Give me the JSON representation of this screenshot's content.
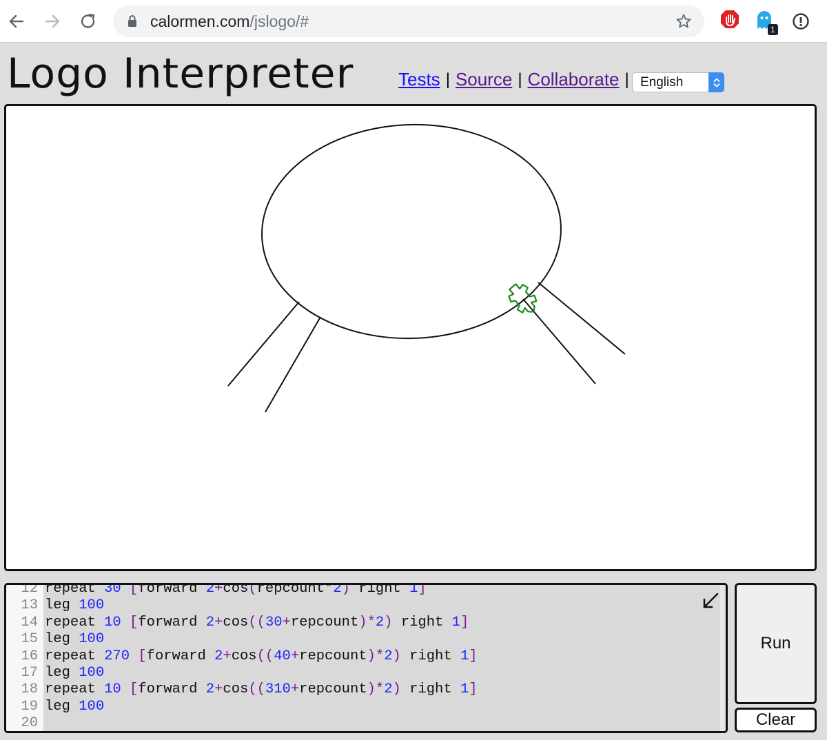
{
  "browser": {
    "url_host": "calormen.com",
    "url_path": "/jslogo/#",
    "extension_badge": "1",
    "icons": [
      "back-arrow-icon",
      "forward-arrow-icon",
      "reload-icon",
      "lock-icon",
      "star-icon",
      "stop-hand-extension-icon",
      "ghost-extension-icon",
      "info-extension-icon"
    ]
  },
  "header": {
    "title": "Logo Interpreter",
    "links": [
      "Tests",
      "Source",
      "Collaborate"
    ],
    "separator": "|",
    "language": "English"
  },
  "colors": {
    "link": "#1a0dff",
    "visited_link": "#551a8b",
    "turtle": "#1a8a1a",
    "select_accent": "#3b8ef0"
  },
  "editor": {
    "lines": [
      {
        "n": "12",
        "code": "repeat 30 [forward 2+cos(repcount*2) right 1]"
      },
      {
        "n": "13",
        "code": "leg 100"
      },
      {
        "n": "14",
        "code": "repeat 10 [forward 2+cos((30+repcount)*2) right 1]"
      },
      {
        "n": "15",
        "code": "leg 100"
      },
      {
        "n": "16",
        "code": "repeat 270 [forward 2+cos((40+repcount)*2) right 1]"
      },
      {
        "n": "17",
        "code": "leg 100"
      },
      {
        "n": "18",
        "code": "repeat 10 [forward 2+cos((310+repcount)*2) right 1]"
      },
      {
        "n": "19",
        "code": "leg 100"
      },
      {
        "n": "20",
        "code": ""
      }
    ]
  },
  "buttons": {
    "run": "Run",
    "clear": "Clear"
  }
}
